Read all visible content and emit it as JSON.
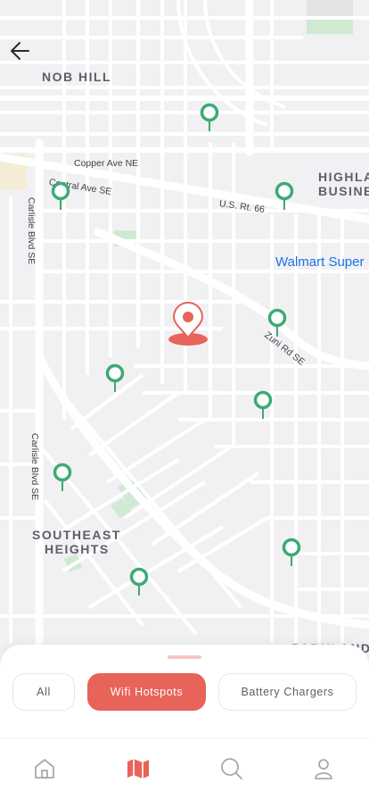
{
  "map": {
    "area_labels": {
      "nob_hill": "NOB HILL",
      "highland_1": "HIGHLA",
      "highland_2": "BUSINE",
      "southeast_1": "SOUTHEAST",
      "southeast_2": "HEIGHTS",
      "parkland": "PARKLAND"
    },
    "road_labels": {
      "copper": "Copper Ave NE",
      "central": "Central Ave SE",
      "us66": "U.S. Rt. 66",
      "zuni": "Zuni Rd SE",
      "carlisle_1": "Carlisle Blvd SE",
      "carlisle_2": "Carlisle Blvd SE"
    },
    "poi": "Walmart Super",
    "hotspot_pin_count": 10
  },
  "icons": {
    "back": "arrow-left-icon",
    "hotspot": "map-pin-icon",
    "current_location": "location-pin-icon",
    "home": "home-icon",
    "map": "map-icon",
    "search": "search-icon",
    "profile": "user-icon"
  },
  "filters": {
    "all": "All",
    "wifi": "Wifi Hotspots",
    "battery": "Battery Chargers",
    "selected": "Wifi Hotspots"
  },
  "colors": {
    "accent": "#E8635A",
    "hotspot_pin": "#3DAA74",
    "map_background": "#F1F1F3",
    "road": "#FFFFFF",
    "park": "#CFE9D3",
    "poi_text": "#1A73E8"
  },
  "tabs": {
    "active": "map"
  }
}
